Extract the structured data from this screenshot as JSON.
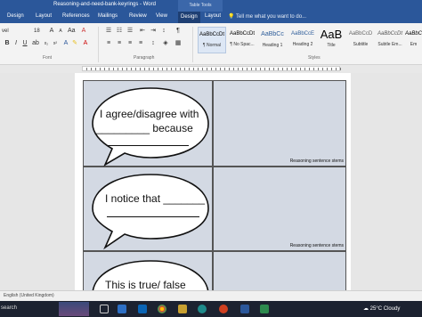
{
  "window": {
    "title": "Reasoning-and-need-bank-keyrings - Word",
    "contextual_tab": "Table Tools"
  },
  "tabs": [
    {
      "label": "Design"
    },
    {
      "label": "Layout"
    },
    {
      "label": "References"
    },
    {
      "label": "Mailings"
    },
    {
      "label": "Review"
    },
    {
      "label": "View"
    },
    {
      "label": "Design"
    },
    {
      "label": "Layout"
    }
  ],
  "tell_me": "Tell me what you want to do...",
  "ribbon": {
    "font_name": "vel",
    "font_size": "18",
    "groups": [
      "Font",
      "Paragraph",
      "Styles"
    ],
    "styles": [
      {
        "sample": "AaBbCcDt",
        "name": "¶ Normal"
      },
      {
        "sample": "AaBbCcDt",
        "name": "¶ No Spac..."
      },
      {
        "sample": "AaBbCc",
        "name": "Heading 1"
      },
      {
        "sample": "AaBbCcE",
        "name": "Heading 2"
      },
      {
        "sample": "AaB",
        "name": "Title"
      },
      {
        "sample": "AaBbCcD",
        "name": "Subtitle"
      },
      {
        "sample": "AaBbCcDt",
        "name": "Subtle Em..."
      },
      {
        "sample": "AaBbC",
        "name": "Em"
      }
    ]
  },
  "document": {
    "cards": [
      {
        "line1": "I agree/disagree with",
        "line2": "_________ because",
        "label": "Reasoning sentence stems"
      },
      {
        "line1": "I notice that _______",
        "label": "Reasoning sentence stems"
      },
      {
        "line1": "This is true/ false"
      }
    ]
  },
  "statusbar": {
    "language": "English (United Kingdom)"
  },
  "taskbar": {
    "search": "search",
    "weather": "25°C  Cloudy"
  },
  "colors": {
    "word_blue": "#2b579a",
    "cell_fill": "#d3d9e3",
    "taskbar": "#1c2230"
  }
}
